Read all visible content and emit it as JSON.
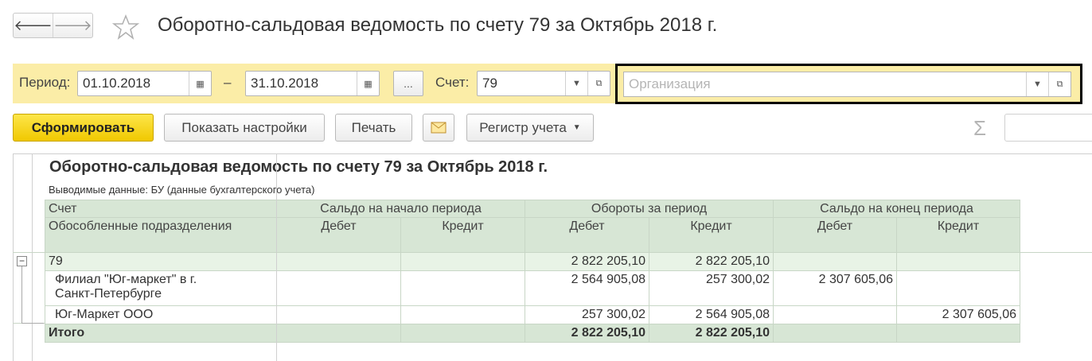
{
  "header": {
    "back_icon": "arrow-left-icon",
    "forward_icon": "arrow-right-icon",
    "favorite_icon": "star-icon",
    "title": "Оборотно-сальдовая ведомость по счету 79 за Октябрь 2018 г."
  },
  "filters": {
    "period_label": "Период:",
    "date_from": "01.10.2018",
    "dash": "–",
    "date_to": "31.10.2018",
    "more_label": "...",
    "account_label": "Счет:",
    "account_value": "79",
    "organization_placeholder": "Организация"
  },
  "toolbar": {
    "generate": "Сформировать",
    "show_settings": "Показать настройки",
    "print": "Печать",
    "email_icon": "envelope-icon",
    "register": "Регистр учета",
    "sigma": "Σ"
  },
  "report": {
    "title": "Оборотно-сальдовая ведомость по счету 79 за Октябрь 2018 г.",
    "subtitle": "Выводимые данные:  БУ (данные бухгалтерского учета)",
    "headers": {
      "account": "Счет",
      "subdivisions": "Обособленные подразделения",
      "opening": "Сальдо на начало периода",
      "turnover": "Обороты за период",
      "closing": "Сальдо на конец периода",
      "debit": "Дебет",
      "credit": "Кредит"
    },
    "rows": [
      {
        "name": "79",
        "od": "",
        "oc": "",
        "td": "2 822 205,10",
        "tc": "2 822 205,10",
        "cd": "",
        "cc": ""
      },
      {
        "name_line1": "Филиал \"Юг-маркет\" в г.",
        "name_line2": "Санкт-Петербурге",
        "od": "",
        "oc": "",
        "td": "2 564 905,08",
        "tc": "257 300,02",
        "cd": "2 307 605,06",
        "cc": ""
      },
      {
        "name": "Юг-Маркет ООО",
        "od": "",
        "oc": "",
        "td": "257 300,02",
        "tc": "2 564 905,08",
        "cd": "",
        "cc": "2 307 605,06"
      }
    ],
    "total": {
      "name": "Итого",
      "td": "2 822 205,10",
      "tc": "2 822 205,10"
    }
  }
}
